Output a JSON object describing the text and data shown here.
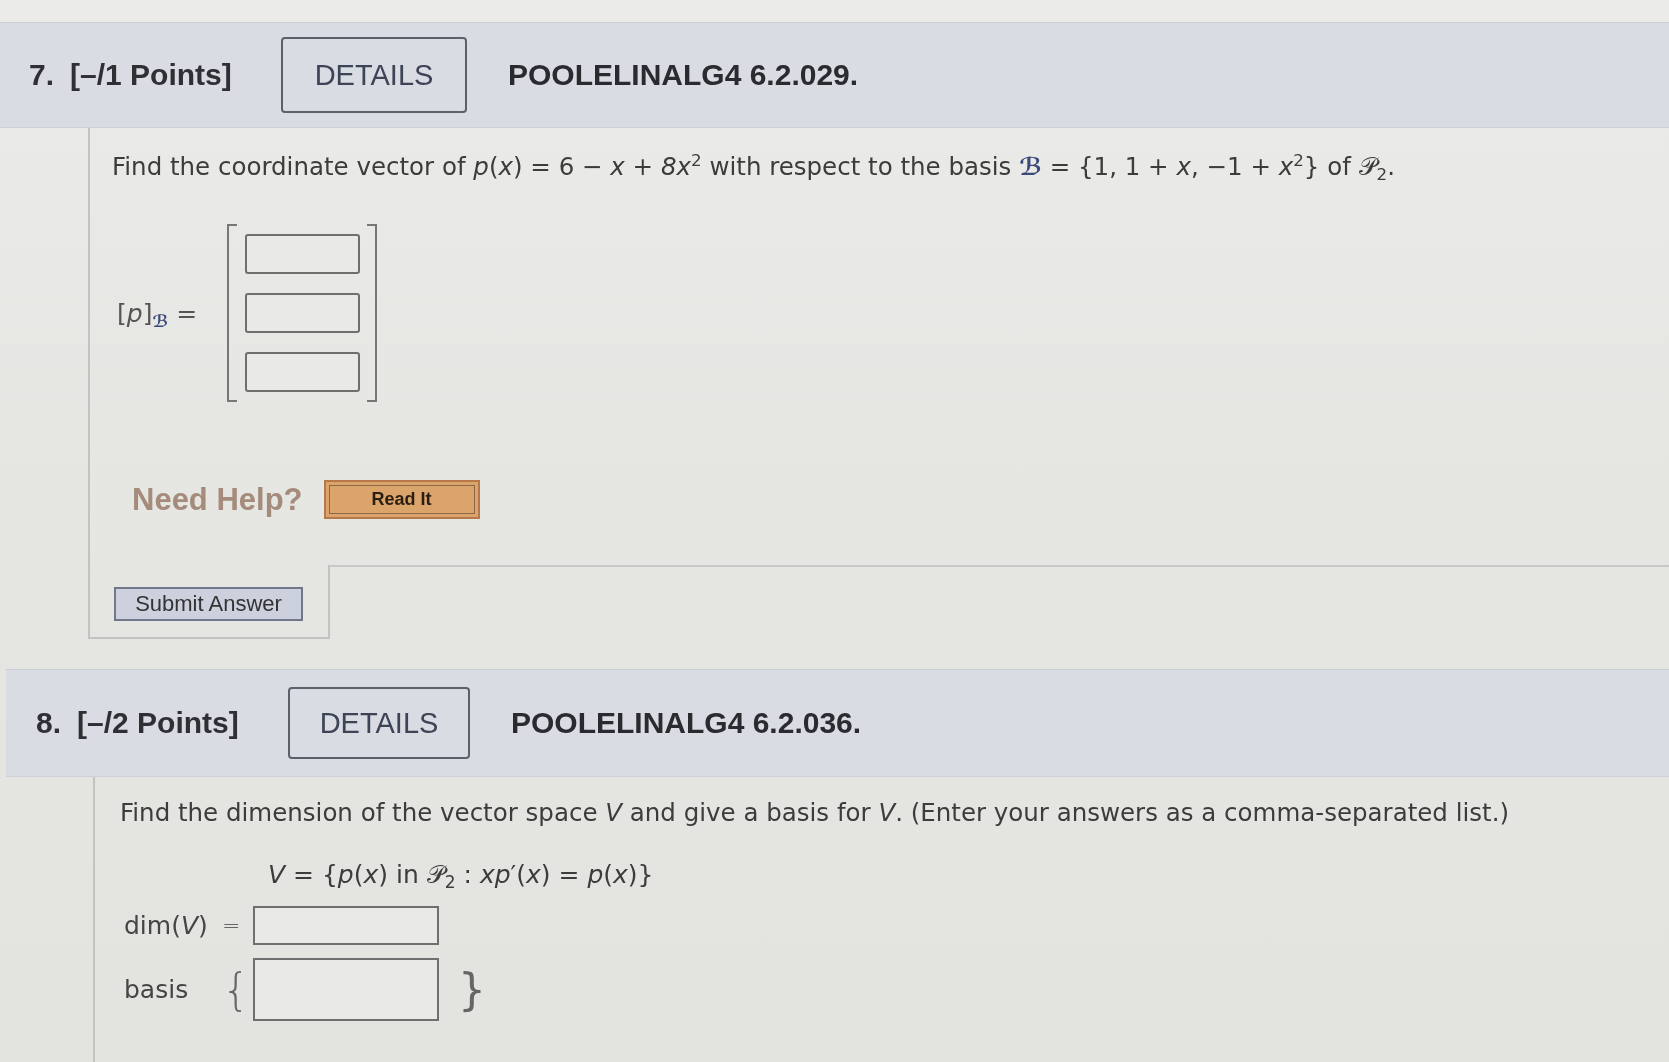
{
  "questions": [
    {
      "number": "7.",
      "points": "[–/1 Points]",
      "details": "DETAILS",
      "code": "POOLELINALG4 6.2.029.",
      "prompt": "Find the coordinate vector of *p*(*x*) = 6 − *x* + *8x*$^{2}$ with respect to the basis **ℬ** = {1, 1 + *x*, −1 + *x*$^{2}$} of 𝒫$_{2}$.",
      "answers": [
        {
          "kind": "vector",
          "label": "[*p*]$_{ℬ}$ =",
          "fields": [
            {
              "kind": "answer-box"
            },
            {
              "kind": "answer-box"
            },
            {
              "kind": "answer-box"
            }
          ]
        }
      ],
      "help": {
        "label": "Need Help?",
        "buttons": [
          "Read It"
        ]
      },
      "submit": "Submit Answer"
    },
    {
      "number": "8.",
      "points": "[–/2 Points]",
      "details": "DETAILS",
      "code": "POOLELINALG4 6.2.036.",
      "prompt": "Find the dimension of the vector space *V* and give a basis for *V*. (Enter your answers as a comma-separated list.)",
      "formula": "*V* = {*p*(*x*) in 𝒫$_{2}$ : *xp*′(*x*) = *p*(*x*)}",
      "answers": [
        {
          "kind": "equals",
          "label": "dim(*V*)",
          "symbol": "="
        },
        {
          "kind": "braced",
          "label": "basis",
          "open": "{",
          "close": "}"
        }
      ]
    }
  ]
}
